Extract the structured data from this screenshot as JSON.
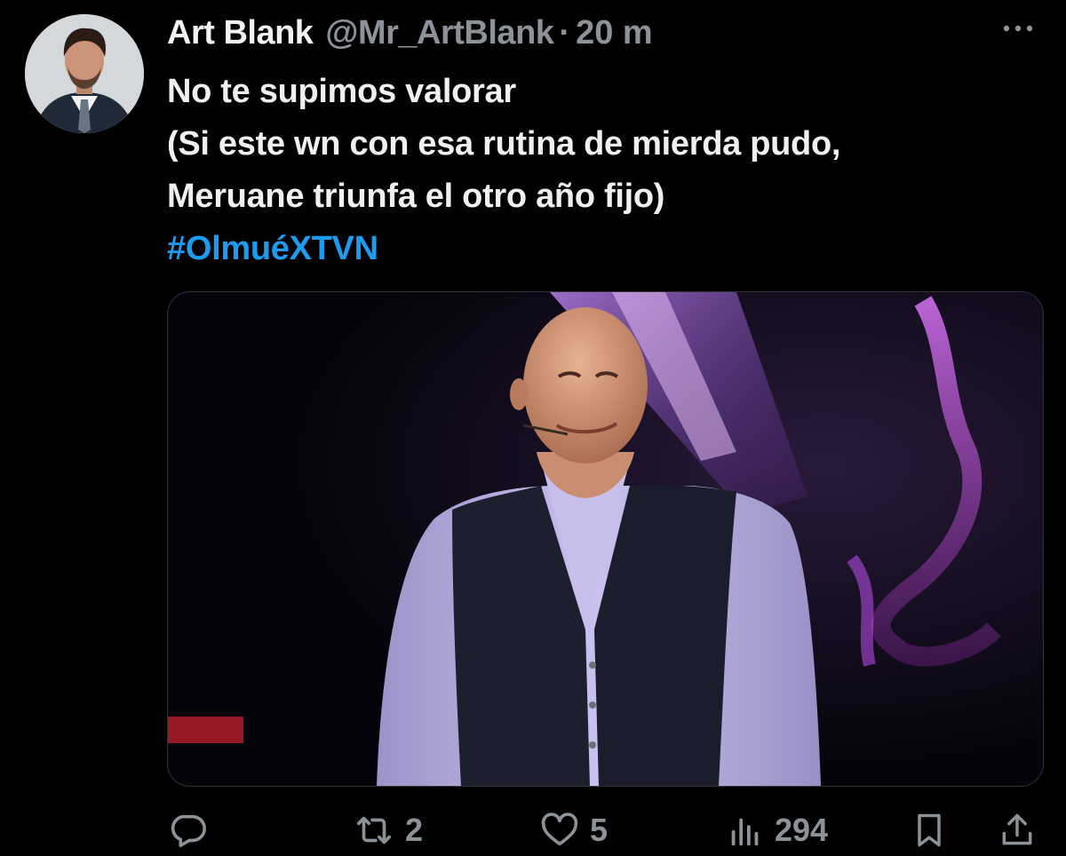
{
  "tweet": {
    "author_name": "Art Blank",
    "author_handle": "@Mr_ArtBlank",
    "separator": "·",
    "timestamp": "20 m",
    "text_lines": [
      "No te supimos valorar",
      "(Si este wn con esa rutina de mierda pudo,",
      "Meruane triunfa el otro año fijo)"
    ],
    "hashtag": "#OlmuéXTVN"
  },
  "actions": {
    "reply_count": "",
    "retweet_count": "2",
    "like_count": "5",
    "views_count": "294"
  },
  "colors": {
    "background": "#000000",
    "text": "#e7e9ea",
    "secondary_text": "#8b9298",
    "link": "#1d9bf0"
  },
  "icons": [
    "more-icon",
    "reply-icon",
    "retweet-icon",
    "like-icon",
    "views-icon",
    "bookmark-icon",
    "share-icon"
  ]
}
